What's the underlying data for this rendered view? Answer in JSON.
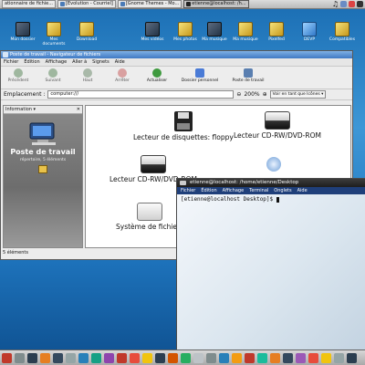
{
  "top_taskbar": {
    "tasks": [
      {
        "label": "ationnaire de fichie...",
        "active": false
      },
      {
        "label": "[Evolution - Courriel]",
        "active": false
      },
      {
        "label": "[Gnome Themes - Mo...",
        "active": false
      },
      {
        "label": "etienne@localhost: /h...",
        "active": true
      }
    ]
  },
  "desktop_icons": [
    {
      "label": "Mon dossier",
      "style": "folder"
    },
    {
      "label": "Mes documents",
      "style": "folder"
    },
    {
      "label": "Download",
      "style": "folder"
    },
    {
      "label": "Mes vidéos",
      "style": "folder"
    },
    {
      "label": "Mes photos",
      "style": "folder"
    },
    {
      "label": "Ma musique",
      "style": "folder"
    },
    {
      "label": "Ma musique",
      "style": "folder"
    },
    {
      "label": "Pixelfed",
      "style": "folder"
    },
    {
      "label": "DEVP",
      "style": "folder"
    },
    {
      "label": "Compatibles",
      "style": "folder"
    }
  ],
  "nautilus": {
    "title": "Poste de travail - Navigateur de fichiers",
    "menu": [
      "Fichier",
      "Édition",
      "Affichage",
      "Aller à",
      "Signets",
      "Aide"
    ],
    "toolbar": [
      {
        "label": "Précédent",
        "enabled": false,
        "icon": "back-arrow-icon"
      },
      {
        "label": "Suivant",
        "enabled": false,
        "icon": "forward-arrow-icon"
      },
      {
        "label": "Haut",
        "enabled": false,
        "icon": "up-arrow-icon"
      },
      {
        "label": "Arrêter",
        "enabled": false,
        "icon": "stop-icon"
      },
      {
        "label": "Actualiser",
        "enabled": true,
        "icon": "reload-icon"
      },
      {
        "label": "Dossier personnel",
        "enabled": true,
        "icon": "home-icon"
      },
      {
        "label": "Poste de travail",
        "enabled": true,
        "icon": "computer-icon"
      }
    ],
    "location_label": "Emplacement :",
    "location_value": "computer:///",
    "zoom": "200%",
    "view_mode": "Voir en tant que Icônes",
    "sidebar_title": "Information",
    "sidebar_heading": "Poste de travail",
    "sidebar_sub": "répertoire, 5 éléments",
    "items": [
      {
        "label": "Lecteur de disquettes: floppy",
        "icon": "floppy-icon"
      },
      {
        "label": "Lecteur CD-RW/DVD-ROM",
        "icon": "cdrom-drive-icon"
      },
      {
        "label": "Lecteur CD-RW/DVD-ROM",
        "icon": "cdrom-drive-icon"
      },
      {
        "label": "Système de fichiers",
        "icon": "hard-disk-icon"
      }
    ],
    "status": "5 éléments"
  },
  "terminal": {
    "title": "etienne@localhost: /home/etienne/Desktop",
    "menu": [
      "Fichier",
      "Édition",
      "Affichage",
      "Terminal",
      "Onglets",
      "Aide"
    ],
    "prompt": "[etienne@localhost Desktop]$ "
  },
  "colors": {
    "desktop": "#2f86cf",
    "nautilus_title": "#3f79c4",
    "terminal_title": "#1d1d1d",
    "terminal_menu": "#1f3f7a"
  }
}
